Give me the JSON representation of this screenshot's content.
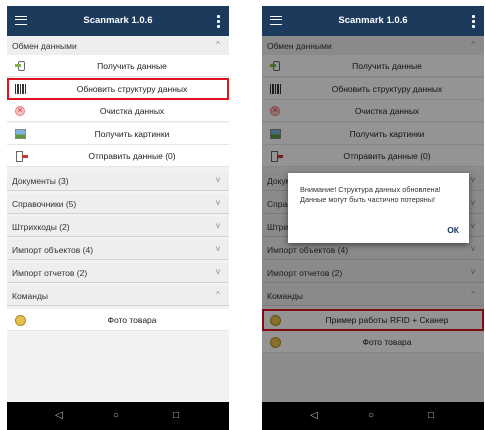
{
  "screens": [
    {
      "app_title": "Scanmark 1.0.6",
      "sections": [
        {
          "label": "Обмен данными",
          "chevron": "^",
          "expanded": true,
          "items": [
            {
              "icon": "phone-import-icon",
              "label": "Получить данные"
            },
            {
              "icon": "barcode-icon",
              "label": "Обновить структуру данных",
              "highlighted": true
            },
            {
              "icon": "clear-icon",
              "label": "Очистка данных"
            },
            {
              "icon": "picture-icon",
              "label": "Получить картинки"
            },
            {
              "icon": "phone-export-icon",
              "label": "Отправить данные (0)"
            }
          ]
        },
        {
          "label": "Документы (3)",
          "chevron": "v"
        },
        {
          "label": "Справочники (5)",
          "chevron": "v"
        },
        {
          "label": "Штрихкоды (2)",
          "chevron": "v"
        },
        {
          "label": "Импорт объектов (4)",
          "chevron": "v"
        },
        {
          "label": "Импорт отчетов (2)",
          "chevron": "v"
        },
        {
          "label": "Команды",
          "chevron": "^",
          "expanded": true,
          "items": [
            {
              "icon": "photo-icon",
              "label": "Фото товара"
            }
          ]
        }
      ],
      "nav": {
        "back": "◁",
        "home": "○",
        "recent": "□"
      }
    },
    {
      "app_title": "Scanmark 1.0.6",
      "sections": [
        {
          "label": "Обмен данными",
          "chevron": "^",
          "expanded": true,
          "items": [
            {
              "icon": "phone-import-icon",
              "label": "Получить данные"
            },
            {
              "icon": "barcode-icon",
              "label": "Обновить структуру данных"
            },
            {
              "icon": "clear-icon",
              "label": "Очистка данных"
            },
            {
              "icon": "picture-icon",
              "label": "Получить картинки"
            },
            {
              "icon": "phone-export-icon",
              "label": "Отправить данные (0)"
            }
          ]
        },
        {
          "label": "Документы (3)",
          "chevron": "v"
        },
        {
          "label": "Справочники (5)",
          "chevron": "v"
        },
        {
          "label": "Штрихкоды (2)",
          "chevron": "v"
        },
        {
          "label": "Импорт объектов (4)",
          "chevron": "v"
        },
        {
          "label": "Импорт отчетов (2)",
          "chevron": "v"
        },
        {
          "label": "Команды",
          "chevron": "^",
          "expanded": true,
          "items": [
            {
              "icon": "photo-icon",
              "label": "Пример работы RFID + Сканер",
              "highlighted": true
            },
            {
              "icon": "photo-icon",
              "label": "Фото товара"
            }
          ]
        }
      ],
      "dialog": {
        "message": "Внимание! Структура данных обновлена! Данные могут быть частично потеряны!",
        "ok_label": "ОК"
      },
      "nav": {
        "back": "◁",
        "home": "○",
        "recent": "□"
      }
    }
  ],
  "colors": {
    "appbar": "#1b3a5c",
    "highlight": "#e0141e"
  }
}
